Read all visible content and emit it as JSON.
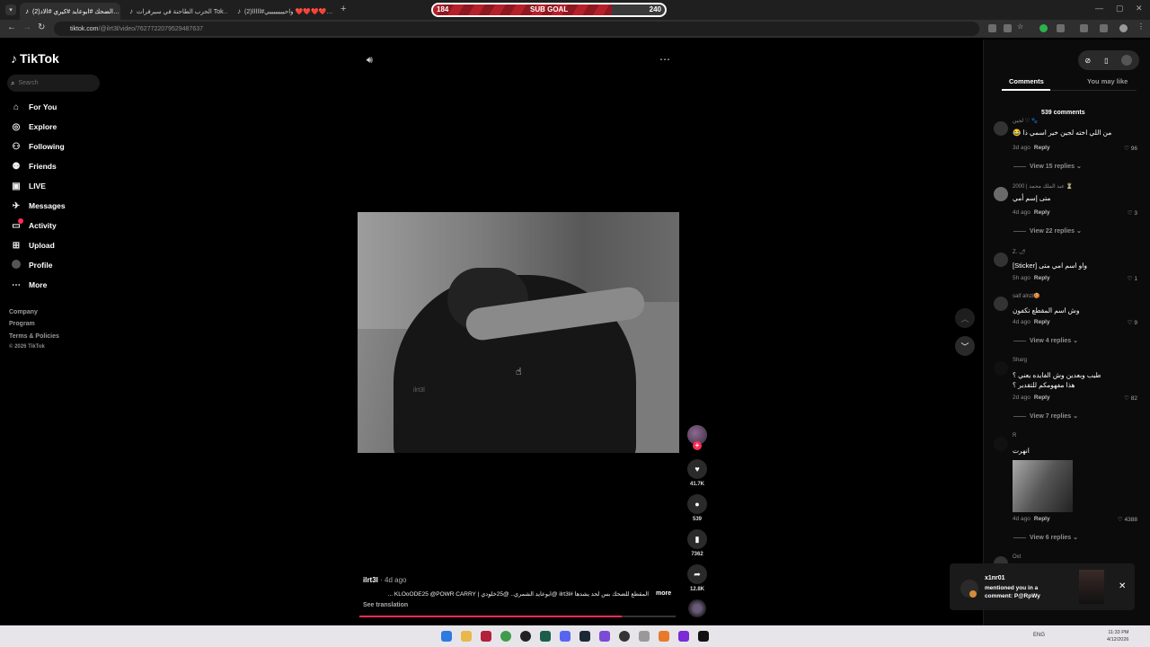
{
  "browser": {
    "tabs": [
      {
        "title": "(2)الضحك #ابوعايد #كيري #الاد…",
        "active": true
      },
      {
        "title": "الحرب الطاحنة في سيرفرات Tok…",
        "active": false
      },
      {
        "title": "(2)واحييييييييي#ااااا ❤️❤️❤️❤️…",
        "active": false
      }
    ],
    "new_tab": "+",
    "url_host": "tiktok.com",
    "url_path": "/@ilrt3l/video/7627722079529487637",
    "subgoal": {
      "left": "184",
      "label": "SUB GOAL",
      "right": "240",
      "progress": 0.77
    }
  },
  "sidebar": {
    "logo": "TikTok",
    "search_placeholder": "Search",
    "nav": [
      {
        "label": "For You",
        "icon": "home-icon"
      },
      {
        "label": "Explore",
        "icon": "compass-icon"
      },
      {
        "label": "Following",
        "icon": "user-follow-icon"
      },
      {
        "label": "Friends",
        "icon": "friends-icon"
      },
      {
        "label": "LIVE",
        "icon": "live-icon"
      },
      {
        "label": "Messages",
        "icon": "messages-icon"
      },
      {
        "label": "Activity",
        "icon": "activity-icon"
      },
      {
        "label": "Upload",
        "icon": "upload-icon"
      },
      {
        "label": "Profile",
        "icon": "avatar"
      },
      {
        "label": "More",
        "icon": "more-icon"
      }
    ],
    "footer": [
      "Company",
      "Program",
      "Terms & Policies"
    ],
    "copyright": "© 2026 TikTok"
  },
  "video": {
    "watermark": "ilrt3l",
    "likes": "41.7K",
    "comments": "539",
    "saves": "7362",
    "shares": "12.8K",
    "progress": 0.83
  },
  "caption": {
    "user": "ilrt3l",
    "date": " · 4d ago",
    "text": "المقطع للضحك بس لحد يشدها #ilrt3l @ابوعايد الشمري.. @25خلودي | KLOoODE25 @POWR CARRY ...",
    "more": "more",
    "see_translation": "See translation"
  },
  "panel": {
    "tabs": [
      "Comments",
      "You may like"
    ],
    "count": "539 comments",
    "comments": [
      {
        "name": "لجين ♡ 🐾",
        "text": "من اللي اخته لجين خير اسمي ذا 😂",
        "time": "3d ago",
        "reply": "Reply",
        "likes": "96",
        "replies": "View 15 replies"
      },
      {
        "name": "عبد الملك محمد | 2000 ⏳",
        "text": "متى إسم أمي",
        "time": "4d ago",
        "reply": "Reply",
        "likes": "3",
        "replies": "View 22 replies"
      },
      {
        "name": "Z. 🌶",
        "text": "واو اسم امي متى [Sticker]",
        "time": "5h ago",
        "reply": "Reply",
        "likes": "1",
        "replies": ""
      },
      {
        "name": "saif alnzi🍪",
        "text": "وش اسم المقطع تكفون",
        "time": "4d ago",
        "reply": "Reply",
        "likes": "9",
        "replies": "View 4 replies"
      },
      {
        "name": "Sharg",
        "text": "طيب وبعدين وش الفايده يعني ؟ هذا مفهومكم للتقدير ؟",
        "time": "2d ago",
        "reply": "Reply",
        "likes": "82",
        "replies": "View 7 replies"
      },
      {
        "name": "R",
        "text": "انهرت",
        "time": "4d ago",
        "reply": "Reply",
        "likes": "4388",
        "replies": "View 6 replies"
      },
      {
        "name": "Oxt",
        "text": "",
        "time": "",
        "reply": "",
        "likes": "",
        "replies": ""
      }
    ]
  },
  "notification": {
    "title": "x1nr01",
    "body": "mentioned you in a comment: P@RpWy"
  },
  "taskbar": {
    "tray": "ENG",
    "time": "11:33 PM",
    "date": "4/12/2026"
  },
  "colors": {
    "accent": "#fe2c55",
    "subgoal": "#b5202a"
  }
}
